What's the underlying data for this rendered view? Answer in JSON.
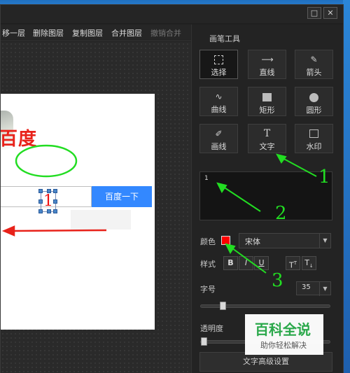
{
  "toolbar": {
    "items": [
      "移一层",
      "删除图层",
      "复制图层",
      "合并图层",
      "撤销合并"
    ]
  },
  "window_controls": {
    "restore_label": "□",
    "close_label": "✕"
  },
  "canvas": {
    "logo_text": "百度",
    "search_button": "百度一下",
    "text_object": "1"
  },
  "panel": {
    "title": "画笔工具",
    "tools": [
      {
        "label": "选择",
        "icon": "select-icon",
        "active": true
      },
      {
        "label": "直线",
        "icon": "line-icon",
        "active": false
      },
      {
        "label": "箭头",
        "icon": "arrow-icon",
        "active": false
      },
      {
        "label": "曲线",
        "icon": "curve-icon",
        "active": false
      },
      {
        "label": "矩形",
        "icon": "rectangle-icon",
        "active": false
      },
      {
        "label": "圆形",
        "icon": "circle-icon",
        "active": false
      },
      {
        "label": "画线",
        "icon": "brush-icon",
        "active": false
      },
      {
        "label": "文字",
        "icon": "text-icon",
        "active": false
      },
      {
        "label": "水印",
        "icon": "watermark-icon",
        "active": false
      }
    ],
    "text_preview": "1",
    "color_label": "颜色",
    "color_value": "#ff0000",
    "font_value": "宋体",
    "style_label": "样式",
    "style_buttons": [
      "B",
      "I",
      "U"
    ],
    "size_label": "字号",
    "size_value": "35",
    "opacity_label": "透明度",
    "advanced_button": "文字高级设置"
  },
  "watermark": {
    "main": "百科全说",
    "sub": "助你轻松解决"
  },
  "annotations": [
    "1",
    "2",
    "3"
  ],
  "colors": {
    "accent_blue": "#3388ff",
    "annotation_green": "#22dd22",
    "arrow_red": "#e8221a"
  }
}
